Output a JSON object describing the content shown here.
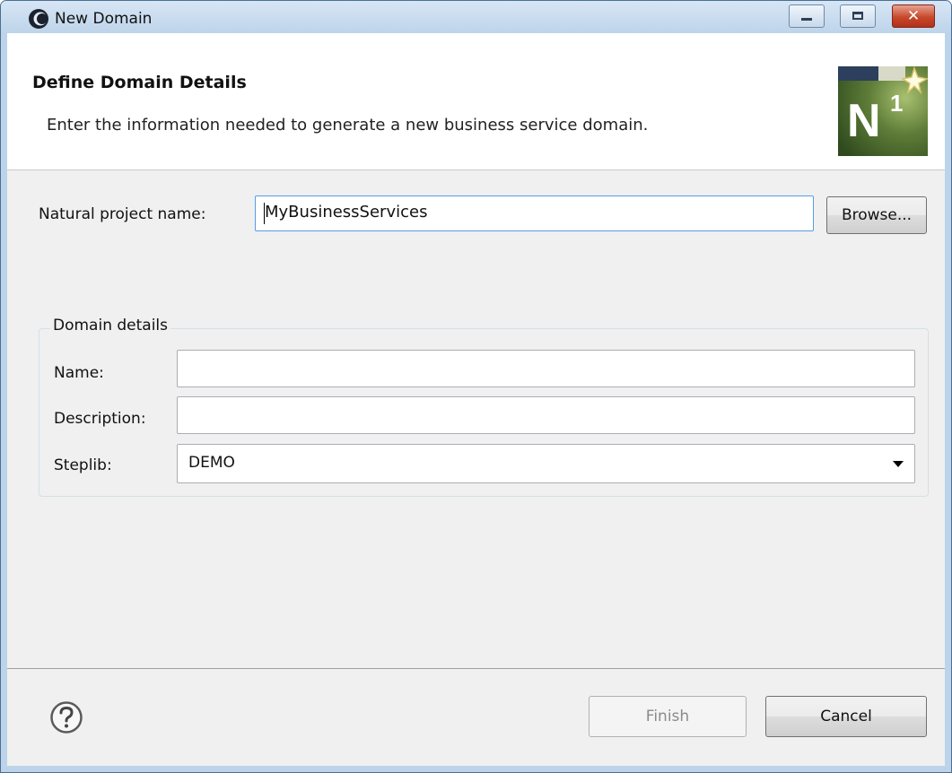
{
  "window": {
    "title": "New Domain",
    "controls": {
      "minimize_icon": "minimize-icon",
      "maximize_icon": "maximize-icon",
      "close_icon": "close-icon"
    }
  },
  "header": {
    "title": "Define Domain Details",
    "description": "Enter the information needed to generate a new business service domain.",
    "logo_text": "N",
    "logo_superscript": "1"
  },
  "form": {
    "project_label": "Natural project name:",
    "project_value": "MyBusinessServices",
    "browse_label": "Browse...",
    "group_title": "Domain details",
    "name_label": "Name:",
    "name_value": "",
    "description_label": "Description:",
    "description_value": "",
    "steplib_label": "Steplib:",
    "steplib_value": "DEMO"
  },
  "footer": {
    "help_icon": "help-icon",
    "finish_label": "Finish",
    "finish_enabled": false,
    "cancel_label": "Cancel"
  },
  "colors": {
    "titlebar": "#bed4ea",
    "body_bg": "#f0f0f0",
    "focus_border": "#569de5",
    "close_button": "#c7482b"
  }
}
